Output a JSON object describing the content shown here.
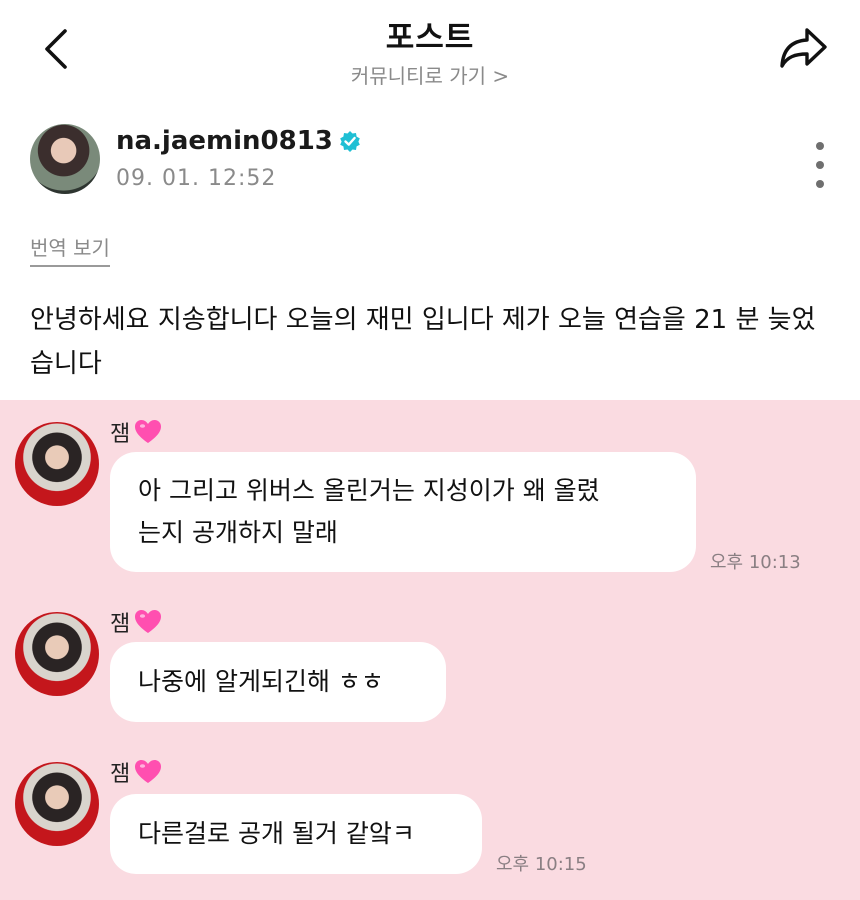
{
  "header": {
    "title": "포스트",
    "community_link": "커뮤니티로 가기 >",
    "back_icon": "chevron-left-icon",
    "share_icon": "share-arrow-icon"
  },
  "post": {
    "username": "na.jaemin0813",
    "verified": true,
    "timestamp": "09. 01. 12:52",
    "translate_label": "번역 보기",
    "body": "안녕하세요 지송합니다 오늘의 재민 입니다 제가 오늘 연습을 21 분 늦었습니다"
  },
  "chat": {
    "background_color": "#fadbe1",
    "messages": [
      {
        "sender": "잼",
        "text_lines": [
          "아 그리고 위버스 올린거는 지성이가 왜 올렸",
          "는지 공개하지 말래"
        ],
        "time": "오후 10:13"
      },
      {
        "sender": "잼",
        "text_lines": [
          "나중에 알게되긴해 ㅎㅎ"
        ],
        "time": ""
      },
      {
        "sender": "잼",
        "text_lines": [
          "다른걸로 공개 될거 같앜ㅋ"
        ],
        "time": "오후 10:15"
      }
    ]
  },
  "colors": {
    "verified_badge": "#1fbfd4",
    "heart": "#ff4fb0",
    "muted_text": "#8a8a8a"
  }
}
